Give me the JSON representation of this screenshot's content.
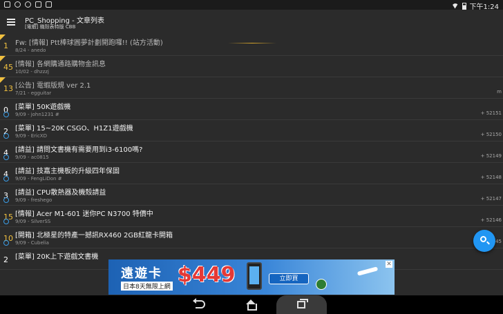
{
  "status_bar": {
    "time": "下午1:24"
  },
  "app": {
    "title": "PC_Shopping - 文章列表",
    "subtitle": "[電蝦] 機殼表特版 CBB"
  },
  "articles": [
    {
      "count": "1",
      "pinned": true,
      "title": "Fw: [情報] Ptt棒球圓夢計劃開跑囉!! (站方活動)",
      "meta": "8/24 - anedo",
      "num": ""
    },
    {
      "count": "45",
      "pinned": true,
      "title": "[情報] 各網購通路購物金訊息",
      "meta": "10/02 - dhzzzj",
      "num": ""
    },
    {
      "count": "13",
      "pinned": true,
      "title": "[公告] 電蝦版規 ver 2.1",
      "meta": "7/21 - egguitar",
      "num": "m"
    },
    {
      "count": "0",
      "pinned": false,
      "title": "[菜單] 50K遊戲機",
      "meta": "9/09 - john1231 #",
      "num": "+ 52151"
    },
    {
      "count": "2",
      "pinned": false,
      "title": "[菜單] 15~20K  CSGO、H1Z1遊戲機",
      "meta": "9/09 - EricXD",
      "num": "+ 52150"
    },
    {
      "count": "4",
      "pinned": false,
      "title": "[請益] 請問文書機有需要用到i3-6100嗎?",
      "meta": "9/09 - ac0815",
      "num": "+ 52149"
    },
    {
      "count": "4",
      "pinned": false,
      "title": "[請益] 技嘉主機板的升級四年保固",
      "meta": "9/09 - FengLiDon #",
      "num": "+ 52148"
    },
    {
      "count": "3",
      "pinned": false,
      "title": "[請益] CPU散熱器及機殼請益",
      "meta": "9/09 - freshego",
      "num": "+ 52147"
    },
    {
      "count": "15",
      "pinned": false,
      "title": "[情報] Acer M1-601 迷你PC  N3700 特價中",
      "meta": "9/09 - SilverSS",
      "num": "+ 52146"
    },
    {
      "count": "10",
      "pinned": false,
      "title": "[開箱] 北極星的特產一撼訊RX460 2GB紅龍卡開箱",
      "meta": "9/09 - Cubelia",
      "num": "45"
    },
    {
      "count": "2",
      "pinned": false,
      "title": "[菜單] 20K上下遊戲文書機",
      "meta": "",
      "num": ""
    }
  ],
  "ad": {
    "title": "遠遊卡",
    "subtitle": "日本8天無限上網",
    "price": "$449",
    "button": "立即買",
    "close": "✕"
  },
  "colors": {
    "accent_blue": "#2196f3",
    "hot_yellow": "#f0c040",
    "price_red": "#e53935"
  },
  "icons": [
    "menu-icon",
    "search-icon",
    "back-icon",
    "home-icon",
    "recent-apps-icon",
    "wifi-icon",
    "battery-icon"
  ]
}
